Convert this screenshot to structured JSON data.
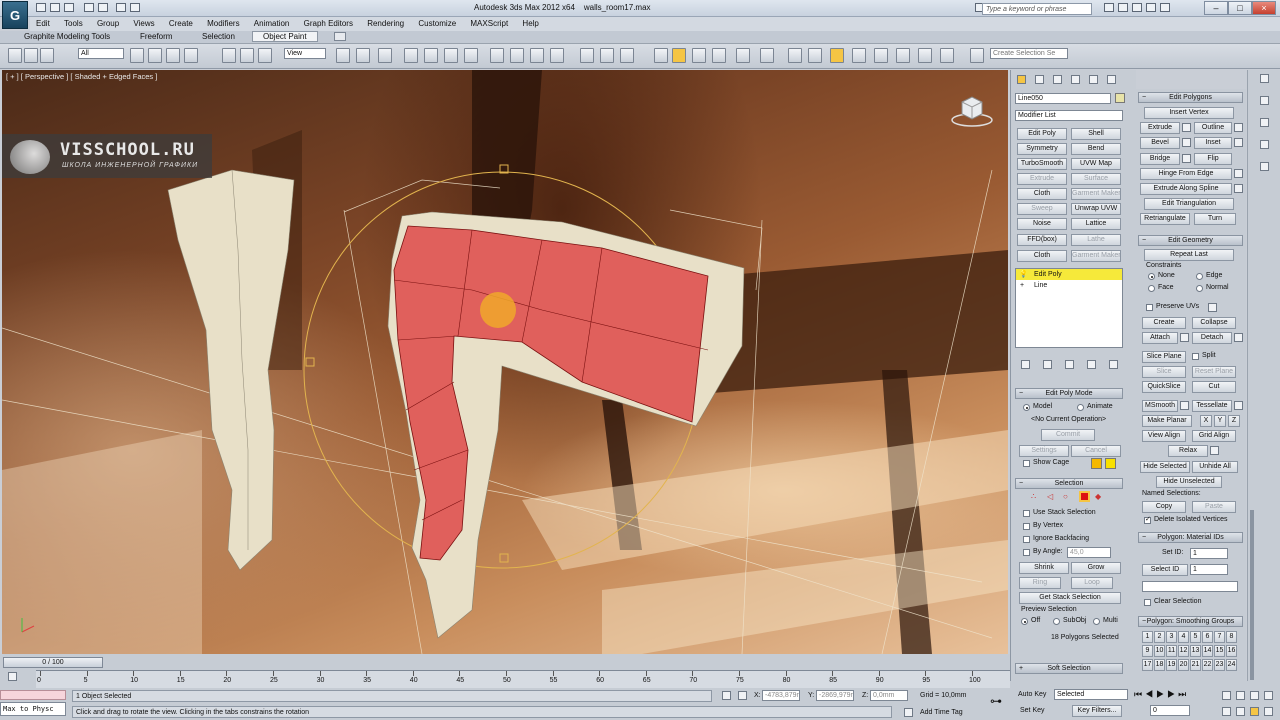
{
  "app": {
    "title": "Autodesk 3ds Max  2012 x64",
    "file": "walls_room17.max",
    "help_search_placeholder": "Type a keyword or phrase",
    "window_buttons": [
      "–",
      "□",
      "×"
    ]
  },
  "menu": [
    "Edit",
    "Tools",
    "Group",
    "Views",
    "Create",
    "Modifiers",
    "Animation",
    "Graph Editors",
    "Rendering",
    "Customize",
    "MAXScript",
    "Help"
  ],
  "ribbon_tabs": {
    "graphite": "Graphite Modeling Tools",
    "freeform": "Freeform",
    "selection": "Selection",
    "object_paint": "Object Paint"
  },
  "toolbar": {
    "selection_filter": "All",
    "coord_system": "View",
    "named_selection_placeholder": "Create Selection Se"
  },
  "viewport": {
    "label": "[ + ] [ Perspective ] [ Shaded + Edged Faces ]",
    "watermark_title": "VISSCHOOL.RU",
    "watermark_subtitle": "ШКОЛА ИНЖЕНЕРНОЙ ГРАФИКИ"
  },
  "command_panel": {
    "object_name": "Line050",
    "modifier_list": "Modifier List",
    "modifier_buttons": [
      {
        "l": "Edit Poly",
        "dis": false
      },
      {
        "l": "Shell",
        "dis": false
      },
      {
        "l": "Symmetry",
        "dis": false
      },
      {
        "l": "Bend",
        "dis": false
      },
      {
        "l": "TurboSmooth",
        "dis": false
      },
      {
        "l": "UVW Map",
        "dis": false
      },
      {
        "l": "Extrude",
        "dis": true
      },
      {
        "l": "Surface",
        "dis": true
      },
      {
        "l": "Cloth",
        "dis": false
      },
      {
        "l": "Garment Maker",
        "dis": true
      },
      {
        "l": "Sweep",
        "dis": true
      },
      {
        "l": "Unwrap UVW",
        "dis": false
      },
      {
        "l": "Noise",
        "dis": false
      },
      {
        "l": "Lattice",
        "dis": false
      },
      {
        "l": "FFD(box)",
        "dis": false
      },
      {
        "l": "Lathe",
        "dis": true
      },
      {
        "l": "Cloth",
        "dis": false
      },
      {
        "l": "Garment Maker",
        "dis": true
      }
    ],
    "stack": [
      "Edit Poly",
      "Line"
    ],
    "edit_poly_mode": {
      "header": "Edit Poly Mode",
      "model": "Model",
      "animate": "Animate",
      "no_op": "<No Current Operation>",
      "commit": "Commit",
      "settings": "Settings",
      "cancel": "Cancel",
      "show_cage": "Show Cage"
    },
    "selection": {
      "header": "Selection",
      "use_stack": "Use Stack Selection",
      "by_vertex": "By Vertex",
      "ignore_backfacing": "Ignore Backfacing",
      "by_angle": "By Angle:",
      "angle_value": "45,0",
      "shrink": "Shrink",
      "grow": "Grow",
      "ring": "Ring",
      "loop": "Loop",
      "get_stack": "Get Stack Selection",
      "preview": "Preview Selection",
      "off": "Off",
      "subobj": "SubObj",
      "multi": "Multi",
      "count": "18 Polygons Selected"
    },
    "soft_selection": "Soft Selection"
  },
  "edit_panel": {
    "edit_polygons": "Edit Polygons",
    "insert_vertex": "Insert Vertex",
    "extrude": "Extrude",
    "outline": "Outline",
    "bevel": "Bevel",
    "inset": "Inset",
    "bridge": "Bridge",
    "flip": "Flip",
    "hinge": "Hinge From Edge",
    "extrude_along": "Extrude Along Spline",
    "edit_tri": "Edit Triangulation",
    "retriangulate": "Retriangulate",
    "turn": "Turn",
    "edit_geometry": "Edit Geometry",
    "repeat_last": "Repeat Last",
    "constraints": "Constraints",
    "c_none": "None",
    "c_edge": "Edge",
    "c_face": "Face",
    "c_normal": "Normal",
    "preserve_uvs": "Preserve UVs",
    "create": "Create",
    "collapse": "Collapse",
    "attach": "Attach",
    "detach": "Detach",
    "slice_plane": "Slice Plane",
    "split": "Split",
    "slice": "Slice",
    "reset_plane": "Reset Plane",
    "quickslice": "QuickSlice",
    "cut": "Cut",
    "msmooth": "MSmooth",
    "tessellate": "Tessellate",
    "make_planar": "Make Planar",
    "x": "X",
    "y": "Y",
    "z": "Z",
    "view_align": "View Align",
    "grid_align": "Grid Align",
    "relax": "Relax",
    "hide_selected": "Hide Selected",
    "unhide_all": "Unhide All",
    "hide_unselected": "Hide Unselected",
    "named_selections": "Named Selections:",
    "copy": "Copy",
    "paste": "Paste",
    "delete_isolated": "Delete Isolated Vertices",
    "material_ids": "Polygon: Material IDs",
    "set_id": "Set ID:",
    "set_id_value": "1",
    "select_id": "Select ID",
    "select_id_value": "1",
    "clear_selection": "Clear Selection",
    "smoothing_groups": "Polygon: Smoothing Groups",
    "sg_numbers": [
      "1",
      "2",
      "3",
      "4",
      "5",
      "6",
      "7",
      "8",
      "9",
      "10",
      "11",
      "12",
      "13",
      "14",
      "15",
      "16",
      "17",
      "18",
      "19",
      "20",
      "21",
      "22",
      "23",
      "24"
    ]
  },
  "timeline": {
    "frame": "0 / 100",
    "ticks": [
      "0",
      "5",
      "10",
      "15",
      "20",
      "25",
      "30",
      "35",
      "40",
      "45",
      "50",
      "55",
      "60",
      "65",
      "70",
      "75",
      "80",
      "85",
      "90",
      "95",
      "100"
    ]
  },
  "status": {
    "objects": "1 Object Selected",
    "prompt": "Click and drag to rotate the view.  Clicking in the tabs constrains the rotation",
    "maxscript": "Max to Physc",
    "x_label": "X:",
    "x": "-4783,879m",
    "y_label": "Y:",
    "y": "-2869,979m",
    "z_label": "Z:",
    "z": "0,0mm",
    "grid": "Grid = 10,0mm",
    "add_time_tag": "Add Time Tag",
    "auto_key": "Auto Key",
    "selected": "Selected",
    "set_key": "Set Key",
    "key_filters": "Key Filters...",
    "frame_field": "0"
  },
  "colors": {
    "selected_poly": "#e0605c",
    "stack_highlight": "#f6e93a",
    "active_tool": "#f5c544"
  }
}
